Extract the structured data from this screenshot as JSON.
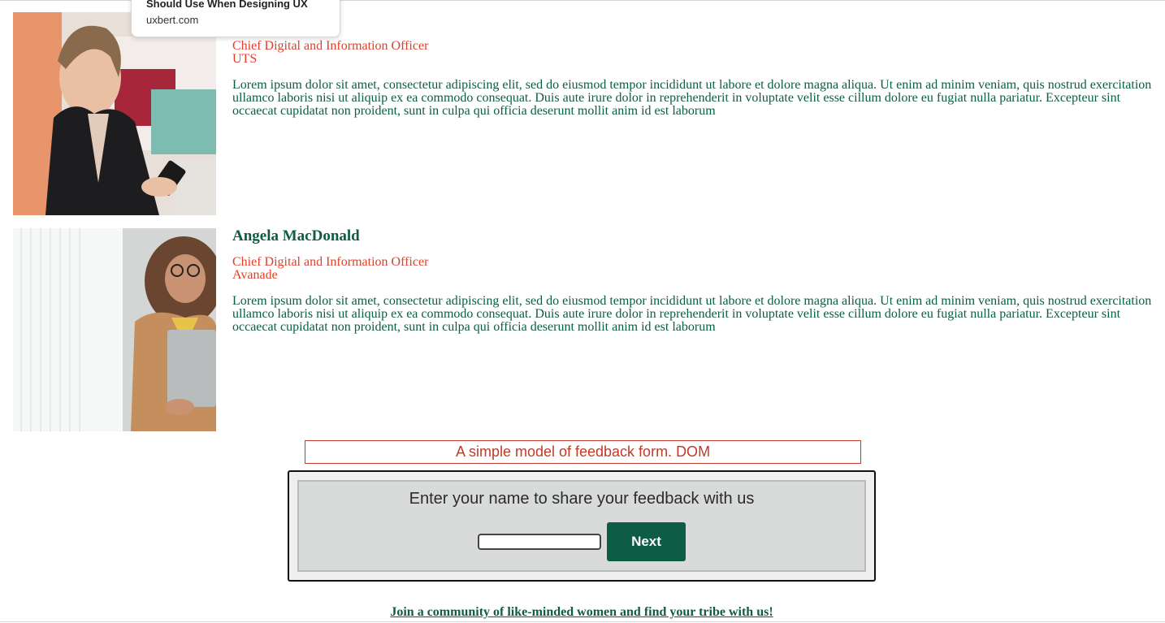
{
  "popup": {
    "title": "Should Use When Designing UX",
    "url": "uxbert.com"
  },
  "profiles": [
    {
      "name": "",
      "role": "Chief Digital and Information Officer",
      "company": "UTS",
      "bio": "Lorem ipsum dolor sit amet, consectetur adipiscing elit, sed do eiusmod tempor incididunt ut labore et dolore magna aliqua. Ut enim ad minim veniam, quis nostrud exercitation ullamco laboris nisi ut aliquip ex ea commodo consequat. Duis aute irure dolor in reprehenderit in voluptate velit esse cillum dolore eu fugiat nulla pariatur. Excepteur sint occaecat cupidatat non proident, sunt in culpa qui officia deserunt mollit anim id est laborum"
    },
    {
      "name": "Angela MacDonald",
      "role": "Chief Digital and Information Officer",
      "company": "Avanade",
      "bio": "Lorem ipsum dolor sit amet, consectetur adipiscing elit, sed do eiusmod tempor incididunt ut labore et dolore magna aliqua. Ut enim ad minim veniam, quis nostrud exercitation ullamco laboris nisi ut aliquip ex ea commodo consequat. Duis aute irure dolor in reprehenderit in voluptate velit esse cillum dolore eu fugiat nulla pariatur. Excepteur sint occaecat cupidatat non proident, sunt in culpa qui officia deserunt mollit anim id est laborum"
    }
  ],
  "feedback": {
    "label": "A simple model of feedback form. DOM",
    "prompt": "Enter your name to share your feedback with us",
    "input_value": "",
    "next_label": "Next"
  },
  "footer": {
    "join_link": "Join a community of like-minded women and find your tribe with us!"
  },
  "colors": {
    "brand_green": "#0d5c45",
    "accent_red": "#e0402a"
  }
}
